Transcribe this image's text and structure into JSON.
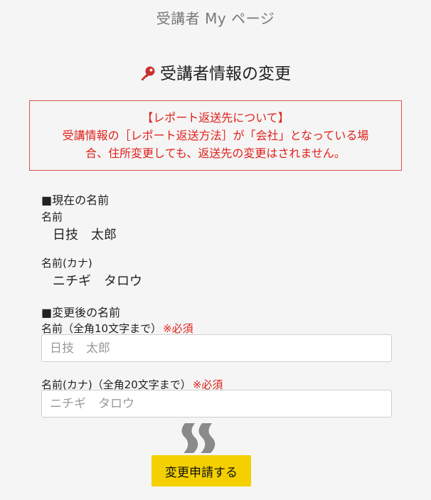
{
  "header": {
    "title": "受講者 My ページ"
  },
  "section": {
    "title": "受講者情報の変更",
    "icon": "key-icon",
    "icon_color": "#c9302c"
  },
  "notice": {
    "heading": "【レポート返送先について】",
    "line1": "受講情報の［レポート返送方法］が「会社」となっている場",
    "line2": "合、住所変更しても、返送先の変更はされません。",
    "color": "#e0211b"
  },
  "current": {
    "heading": "■現在の名前",
    "name_label": "名前",
    "name_value": "日技　太郎",
    "kana_label": "名前(カナ)",
    "kana_value": "ニチギ　タロウ"
  },
  "new": {
    "heading": "■変更後の名前",
    "name_label": "名前（全角10文字まで）",
    "name_required": "※必須",
    "name_placeholder": "日技　太郎",
    "kana_label": "名前(カナ)（全角20文字まで）",
    "kana_required": "※必須",
    "kana_placeholder": "ニチギ　タロウ"
  },
  "actions": {
    "submit_label": "変更申請する",
    "submit_color": "#f4d000"
  }
}
